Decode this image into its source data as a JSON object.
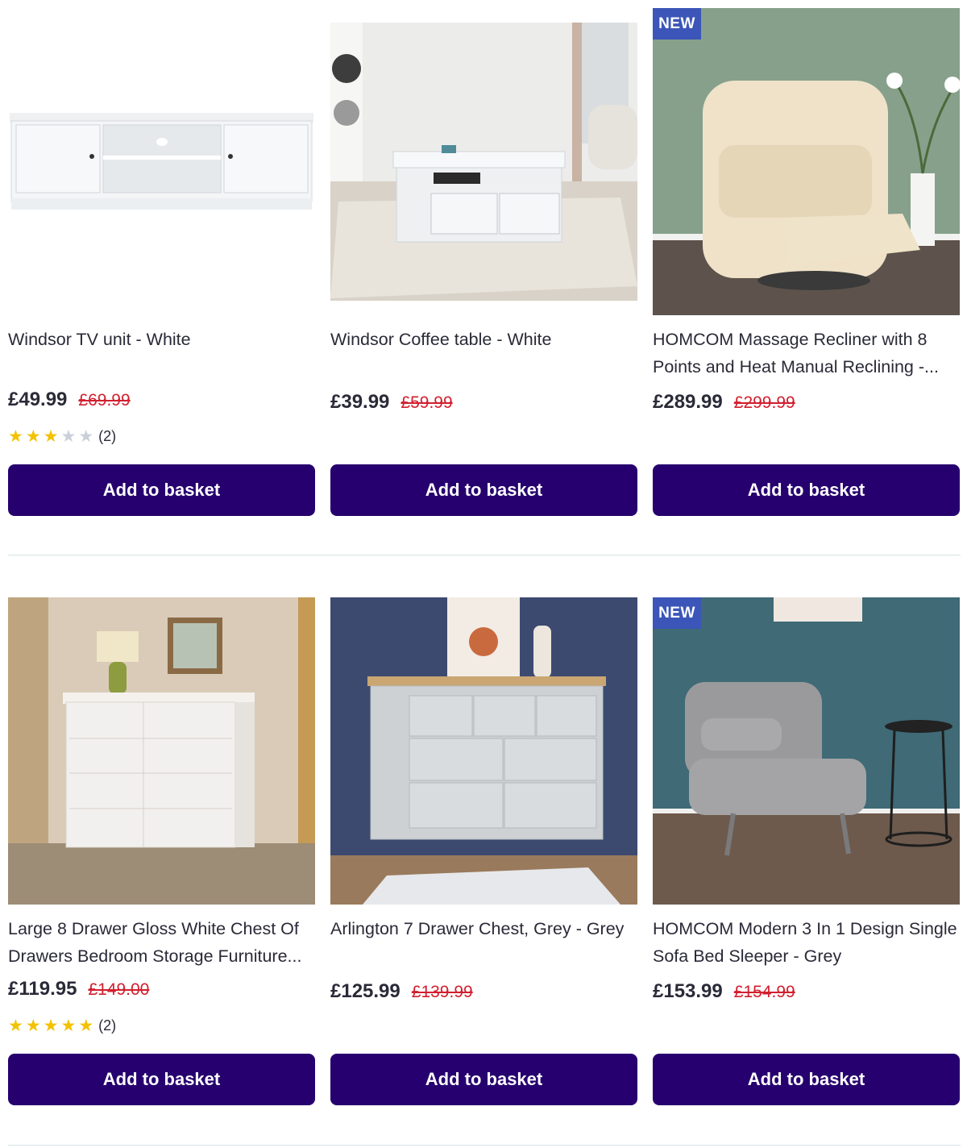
{
  "colors": {
    "button": "#26006e",
    "badge": "#3b55b8",
    "was_price": "#d21f2f",
    "star": "#f2c200",
    "divider": "#d4e3e3"
  },
  "products": [
    {
      "title": "Windsor TV unit - White",
      "price": "£49.99",
      "was": "£69.99",
      "badge": "",
      "rating": 3,
      "rating_count": "(2)",
      "button": "Add to basket",
      "image": "tv-unit-image"
    },
    {
      "title": "Windsor Coffee table - White",
      "price": "£39.99",
      "was": "£59.99",
      "badge": "",
      "button": "Add to basket",
      "image": "coffee-table-image"
    },
    {
      "title": "HOMCOM Massage Recliner with 8 Points and Heat Manual Reclining -...",
      "price": "£289.99",
      "was": "£299.99",
      "badge": "NEW",
      "button": "Add to basket",
      "image": "recliner-image"
    },
    {
      "title": "Large 8 Drawer Gloss White Chest Of Drawers Bedroom Storage Furniture...",
      "price": "£119.95",
      "was": "£149.00",
      "badge": "",
      "rating": 5,
      "rating_count": "(2)",
      "button": "Add to basket",
      "image": "white-chest-image"
    },
    {
      "title": "Arlington 7 Drawer Chest, Grey - Grey",
      "price": "£125.99",
      "was": "£139.99",
      "badge": "",
      "button": "Add to basket",
      "image": "grey-chest-image"
    },
    {
      "title": "HOMCOM Modern 3 In 1 Design Single Sofa Bed Sleeper - Grey",
      "price": "£153.99",
      "was": "£154.99",
      "badge": "NEW",
      "button": "Add to basket",
      "image": "sofa-bed-image"
    }
  ]
}
